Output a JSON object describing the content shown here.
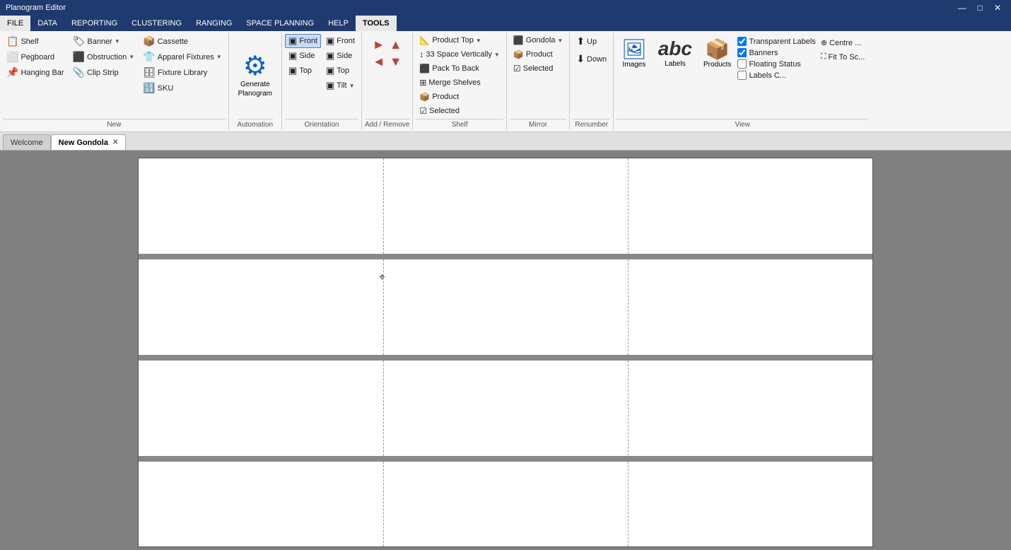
{
  "titleBar": {
    "title": "Planogram Editor",
    "minimize": "—",
    "maximize": "□",
    "close": "✕"
  },
  "menuBar": {
    "items": [
      {
        "label": "FILE",
        "active": true
      },
      {
        "label": "DATA",
        "active": false
      },
      {
        "label": "REPORTING",
        "active": false
      },
      {
        "label": "CLUSTERING",
        "active": false
      },
      {
        "label": "RANGING",
        "active": false
      },
      {
        "label": "SPACE PLANNING",
        "active": false
      },
      {
        "label": "HELP",
        "active": false
      },
      {
        "label": "TOOLS",
        "active": false
      }
    ]
  },
  "ribbon": {
    "groups": [
      {
        "label": "New",
        "items": [
          {
            "label": "Shelf",
            "icon": "📋"
          },
          {
            "label": "Pegboard",
            "icon": "⬜"
          },
          {
            "label": "Hanging Bar",
            "icon": "📌"
          },
          {
            "label": "Banner",
            "icon": "🏷",
            "dropdown": true
          },
          {
            "label": "Obstruction",
            "icon": "⬛",
            "dropdown": true
          },
          {
            "label": "Clip Strip",
            "icon": "📎"
          },
          {
            "label": "Cassette",
            "icon": "📦"
          },
          {
            "label": "Apparel Fixtures",
            "icon": "👕",
            "dropdown": true
          },
          {
            "label": "Fixture Library",
            "icon": "🗄"
          },
          {
            "label": "SKU",
            "icon": "🔢"
          }
        ]
      },
      {
        "label": "Automation",
        "items": [
          {
            "label": "Generate\nPlanogram",
            "icon": "⚙",
            "big": true
          }
        ]
      },
      {
        "label": "Orientation",
        "items": [
          {
            "label": "Front",
            "icon": "▣",
            "active": true
          },
          {
            "label": "Side",
            "icon": "▣"
          },
          {
            "label": "Top",
            "icon": "▣"
          },
          {
            "label": "Front",
            "icon": "▣"
          },
          {
            "label": "Side",
            "icon": "▣"
          },
          {
            "label": "Top",
            "icon": "▣"
          },
          {
            "label": "Tilt",
            "icon": "▣",
            "dropdown": true
          }
        ]
      },
      {
        "label": "Add / Remove",
        "arrows": [
          "►",
          "◄",
          "▲",
          "▼"
        ]
      },
      {
        "label": "Shelf",
        "items": [
          {
            "label": "Product Top",
            "dropdown": true
          },
          {
            "label": "Space Vertically",
            "prefix": "33",
            "dropdown": true
          },
          {
            "label": "Pack To Back"
          },
          {
            "label": "Merge Shelves"
          },
          {
            "label": "Product",
            "icon": "📦"
          },
          {
            "label": "Selected",
            "icon": "☑"
          }
        ]
      },
      {
        "label": "Mirror",
        "items": [
          {
            "label": "Gondola",
            "icon": "⬜",
            "dropdown": true
          },
          {
            "label": "Product",
            "icon": "📦"
          },
          {
            "label": "Selected",
            "icon": "☑"
          }
        ]
      },
      {
        "label": "Renumber",
        "items": [
          {
            "label": "Up",
            "icon": "⬆"
          },
          {
            "label": "Down",
            "icon": "⬇"
          }
        ]
      },
      {
        "label": "View",
        "items": [
          {
            "label": "Images",
            "icon": "🖼"
          },
          {
            "label": "Labels",
            "icon": "abc"
          },
          {
            "label": "Products",
            "icon": "📦"
          },
          {
            "label": "Transparent Labels",
            "checkbox": true,
            "checked": true
          },
          {
            "label": "Banners",
            "checkbox": true,
            "checked": true
          },
          {
            "label": "Floating Status",
            "checkbox": true,
            "checked": false
          },
          {
            "label": "Labels C...",
            "checkbox": true,
            "checked": false
          },
          {
            "label": "Centre ...",
            "icon": "⊕"
          },
          {
            "label": "Fit To Sc...",
            "icon": "⛶"
          }
        ]
      }
    ]
  },
  "tabs": [
    {
      "label": "Welcome",
      "active": false,
      "closeable": false
    },
    {
      "label": "New Gondola",
      "active": true,
      "closeable": true
    }
  ],
  "planogram": {
    "shelves": 4,
    "dividers": [
      0.33,
      0.66
    ]
  }
}
